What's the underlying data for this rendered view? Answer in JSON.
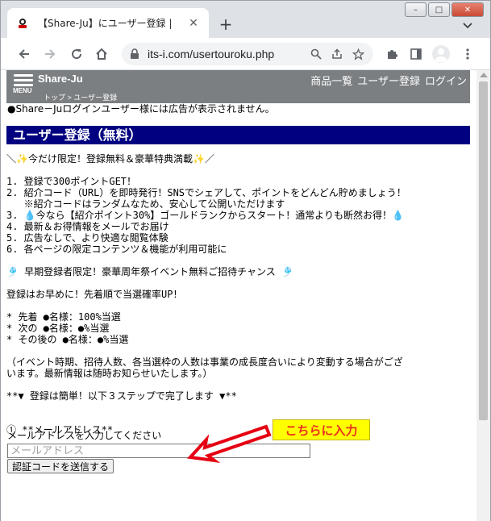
{
  "browser": {
    "tab_title": "【Share-Ju】にユーザー登録 |",
    "url": "its-i.com/usertouroku.php"
  },
  "header": {
    "menu_label": "MENU",
    "site_name": "Share-Ju",
    "breadcrumb": "トップ > ユーザー登録",
    "nav": [
      "商品一覧",
      "ユーザー登録",
      "ログイン"
    ]
  },
  "notice": "●Share－Juログインユーザー様には広告が表示されません。",
  "heading": "ユーザー登録（無料）",
  "lines": [
    "＼✨今だけ限定！登録無料＆豪華特典満載✨／",
    "",
    "1. 登録で300ポイントGET！",
    "2. 紹介コード（URL）を即時発行！SNSでシェアして、ポイントをどんどん貯めましょう！",
    "   ※紹介コードはランダムなため、安心して公開いただけます",
    "3. 💧今なら【紹介ポイント30%】ゴールドランクからスタート！通常よりも断然お得！💧",
    "4. 最新＆お得情報をメールでお届け",
    "5. 広告なしで、より快適な閲覧体験",
    "6. 各ページの限定コンテンツ＆機能が利用可能に",
    "",
    "🎐 早期登録者限定！豪華周年祭イベント無料ご招待チャンス 🎐",
    "",
    "登録はお早めに！先着順で当選確率UP！",
    "",
    "* 先着 ●名様：100%当選",
    "* 次の ●名様：●%当選",
    "* その後の ●名様：●%当選",
    "",
    "（イベント時期、招待人数、各当選枠の人数は事業の成長度合いにより変動する場合がござ",
    "います。最新情報は随時お知らせいたします。）",
    "",
    "**▼ 登録は簡単！以下３ステップで完了します ▼**",
    "",
    "",
    "① **メールアドレス**"
  ],
  "email_label": "メールアドレスを入力してください",
  "email_placeholder": "メールアドレス",
  "send_button": "認証コードを送信する",
  "callout": "こちらに入力",
  "colors": {
    "heading_bg": "#000080",
    "header_bg": "#7b7f82",
    "callout_bg": "#ffff00",
    "callout_text": "#e8301c",
    "arrow": "#e60012"
  }
}
